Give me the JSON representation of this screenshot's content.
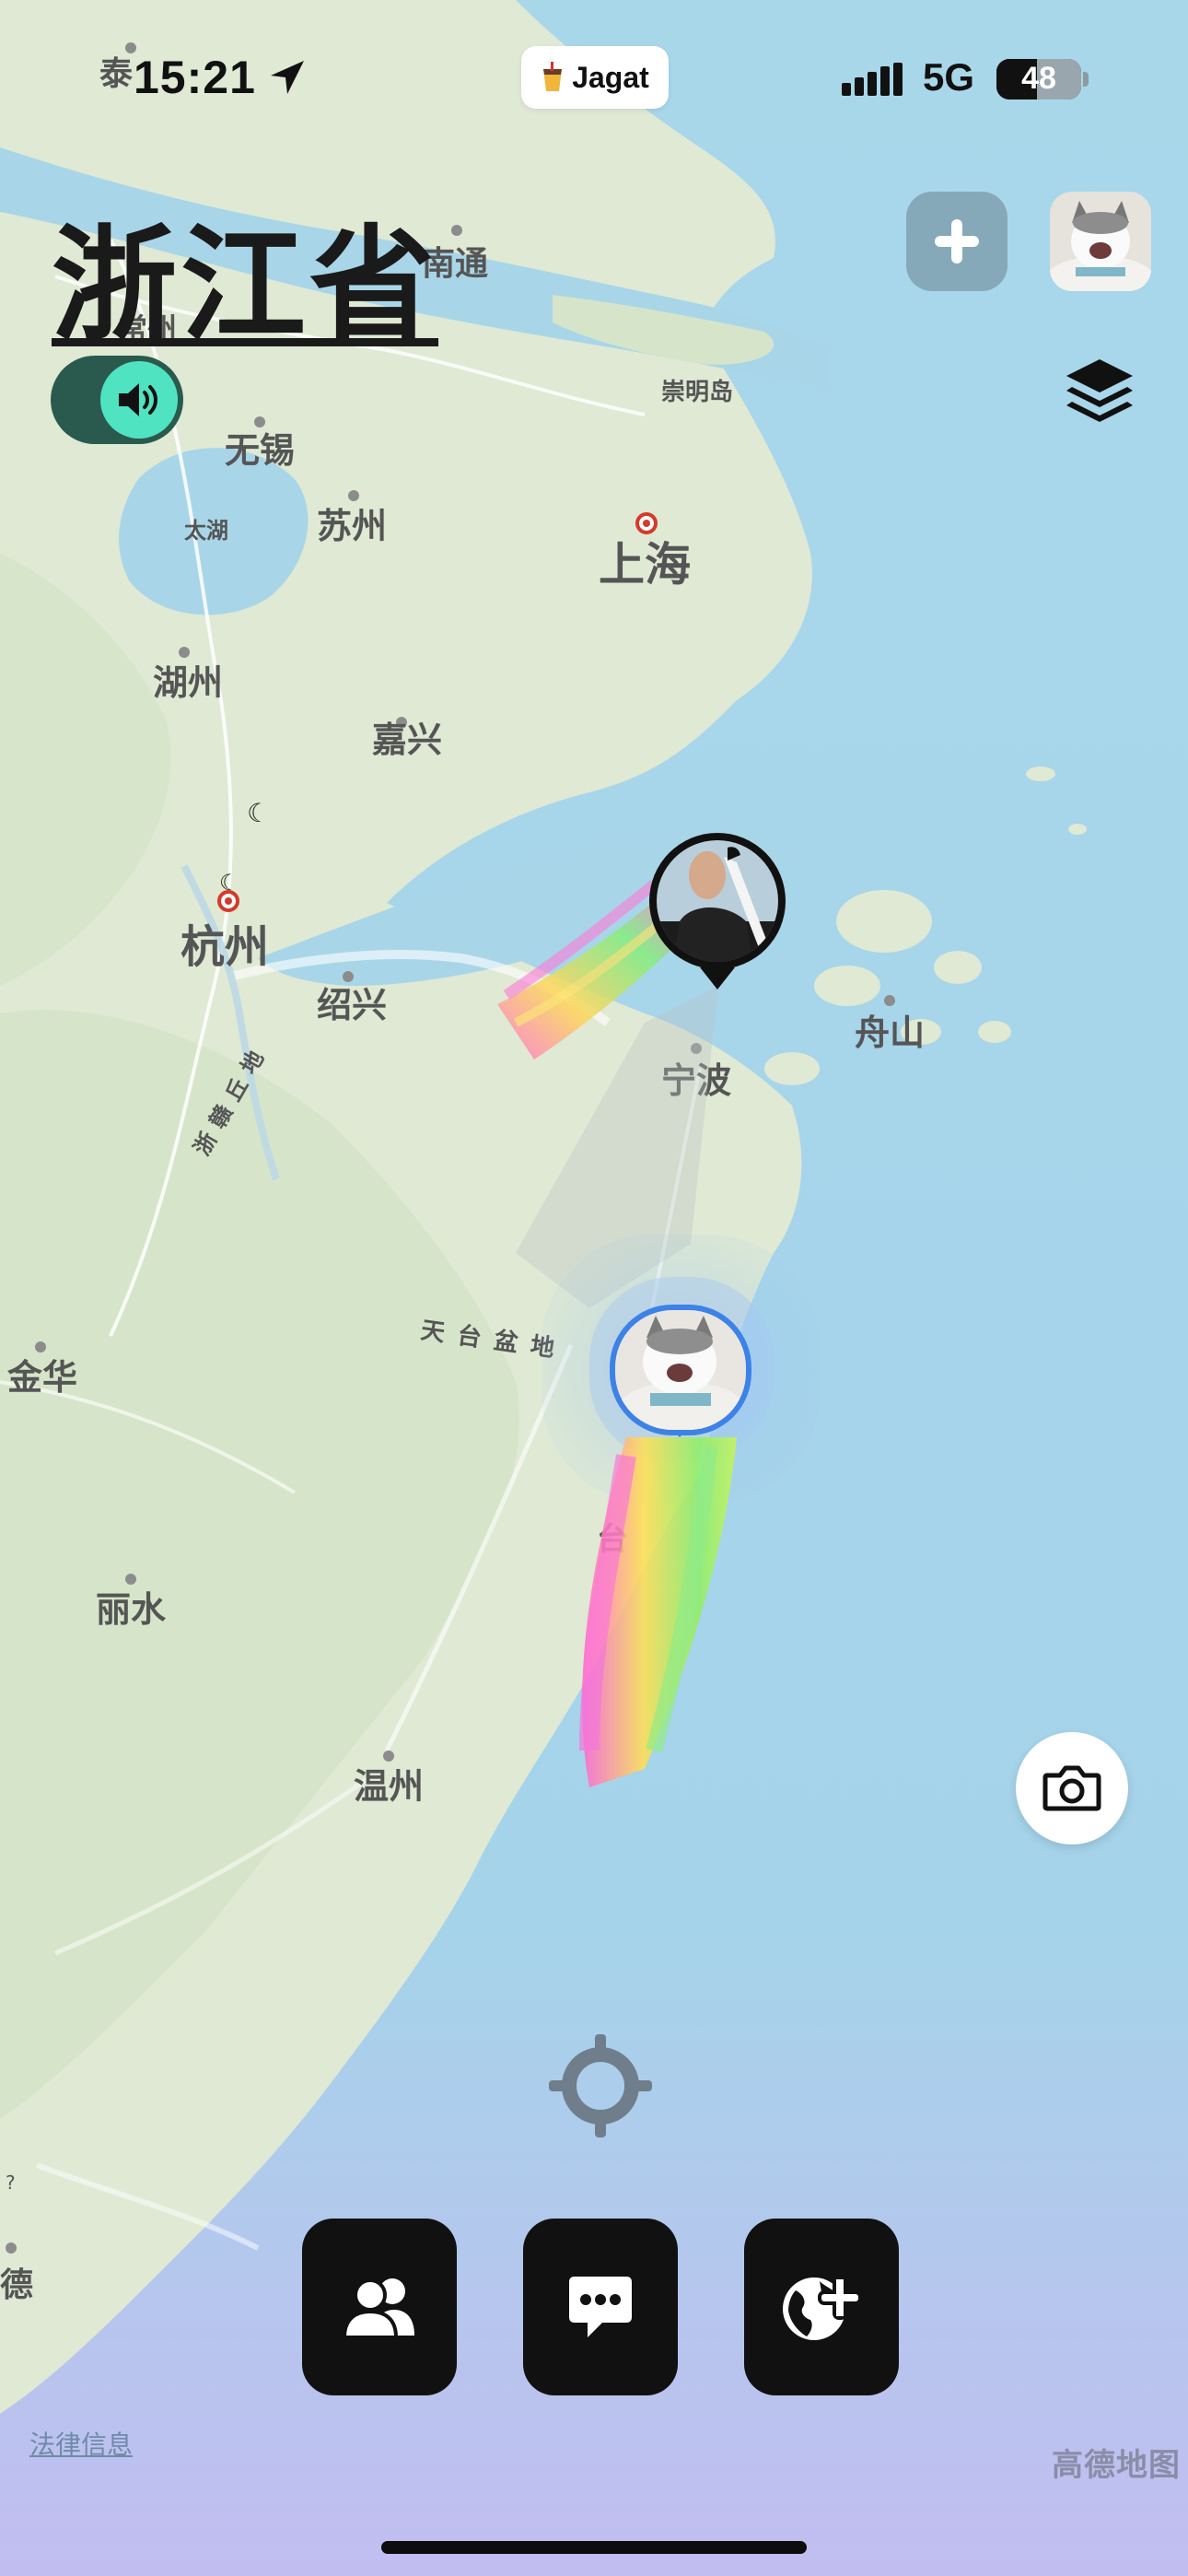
{
  "status_bar": {
    "time": "15:21",
    "app_name": "Jagat",
    "network": "5G",
    "battery": "48",
    "battery_level": 0.48
  },
  "header": {
    "region_title": "浙江省",
    "sound_toggle_on": true
  },
  "map": {
    "labels": {
      "nantong": "南通",
      "chongming": "崇明岛",
      "wuxi": "无锡",
      "changzhou": "常州",
      "taizhou_north": "泰",
      "taihu": "太湖",
      "suzhou": "苏州",
      "shanghai": "上海",
      "huzhou": "湖州",
      "jiaxing": "嘉兴",
      "hangzhou": "杭州",
      "shaoxing": "绍兴",
      "ningbo": "宁波",
      "zhoushan": "舟山",
      "jinhua": "金华",
      "lishui": "丽水",
      "wenzhou": "温州",
      "tiantai": "天台盆地",
      "zhepu": "浙赣丘地",
      "taizhou_partial": "台",
      "de_partial": "德",
      "question": "?"
    },
    "markers": [
      {
        "name": "friend-marker",
        "avatar": "person-photo",
        "ring_color": "#111111"
      },
      {
        "name": "self-marker",
        "avatar": "cat-photo",
        "ring_color": "#3d82e6"
      }
    ],
    "colors": {
      "sea": "#a8d6e8",
      "land": "#dde8d2",
      "trail": [
        "#ff6ad5",
        "#ffd84a",
        "#7cf07a",
        "#b4f25a"
      ]
    }
  },
  "controls": {
    "add_icon": "plus-icon",
    "layers_icon": "layers-icon",
    "camera_icon": "camera-icon",
    "locate_icon": "crosshair-icon"
  },
  "dock": {
    "friends_icon": "people-icon",
    "chat_icon": "chat-bubble-icon",
    "globe_icon": "globe-plus-icon"
  },
  "footer": {
    "legal": "法律信息",
    "attribution": "高德地图"
  }
}
